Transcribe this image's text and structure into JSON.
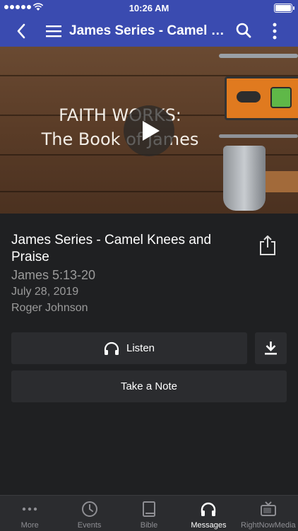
{
  "status_bar": {
    "time": "10:26 AM"
  },
  "header": {
    "title": "James Series - Camel Kne..."
  },
  "hero": {
    "line1": "FAITH WORKS:",
    "line2": "The Book of James"
  },
  "message": {
    "title": "James Series - Camel Knees and Praise",
    "scripture": "James 5:13-20",
    "date": "July 28, 2019",
    "speaker": "Roger Johnson"
  },
  "actions": {
    "listen_label": "Listen",
    "note_label": "Take a Note"
  },
  "tabs": [
    {
      "label": "More",
      "icon": "more-dots-icon",
      "active": false
    },
    {
      "label": "Events",
      "icon": "clock-icon",
      "active": false
    },
    {
      "label": "Bible",
      "icon": "book-icon",
      "active": false
    },
    {
      "label": "Messages",
      "icon": "headphones-icon",
      "active": true
    },
    {
      "label": "RightNowMedia",
      "icon": "tv-icon",
      "active": false
    }
  ],
  "colors": {
    "nav_bar": "#3a4bb0",
    "background": "#1f2022",
    "button": "#2b2c2f",
    "muted_text": "#9b9b9b"
  }
}
